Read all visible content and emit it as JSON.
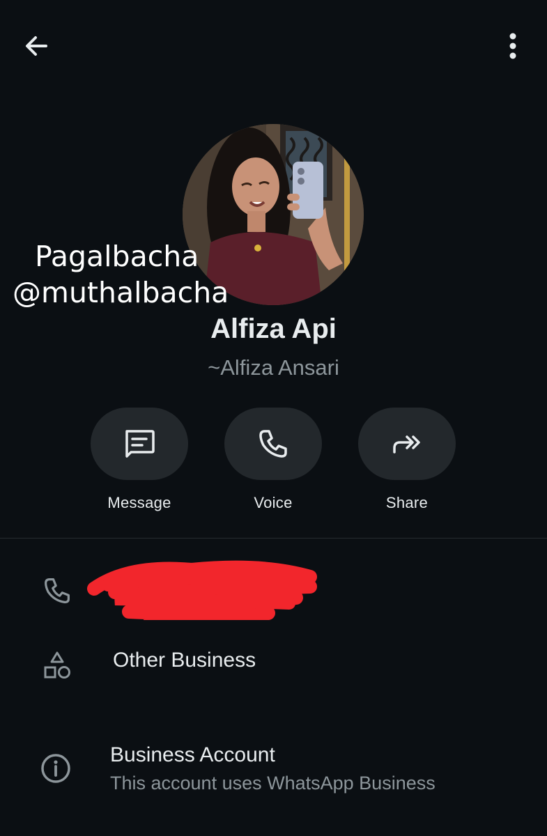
{
  "header": {
    "back_icon": "arrow-left-icon",
    "menu_icon": "more-vertical-icon"
  },
  "watermark": {
    "line1": "Pagalbacha",
    "line2": "@muthalbacha"
  },
  "contact": {
    "name": "Alfiza Api",
    "subtitle": "~Alfiza Ansari"
  },
  "actions": [
    {
      "label": "Message",
      "icon": "message-icon"
    },
    {
      "label": "Voice",
      "icon": "phone-icon"
    },
    {
      "label": "Share",
      "icon": "share-icon"
    }
  ],
  "info": {
    "phone_icon": "phone-icon",
    "category_icon": "shapes-icon",
    "category": "Other Business",
    "account_icon": "info-icon",
    "account_title": "Business Account",
    "account_subtitle": "This account uses WhatsApp Business"
  },
  "colors": {
    "background": "#0b0f13",
    "pill": "#23282c",
    "redaction": "#f2262c",
    "secondary_text": "#8d969b"
  }
}
